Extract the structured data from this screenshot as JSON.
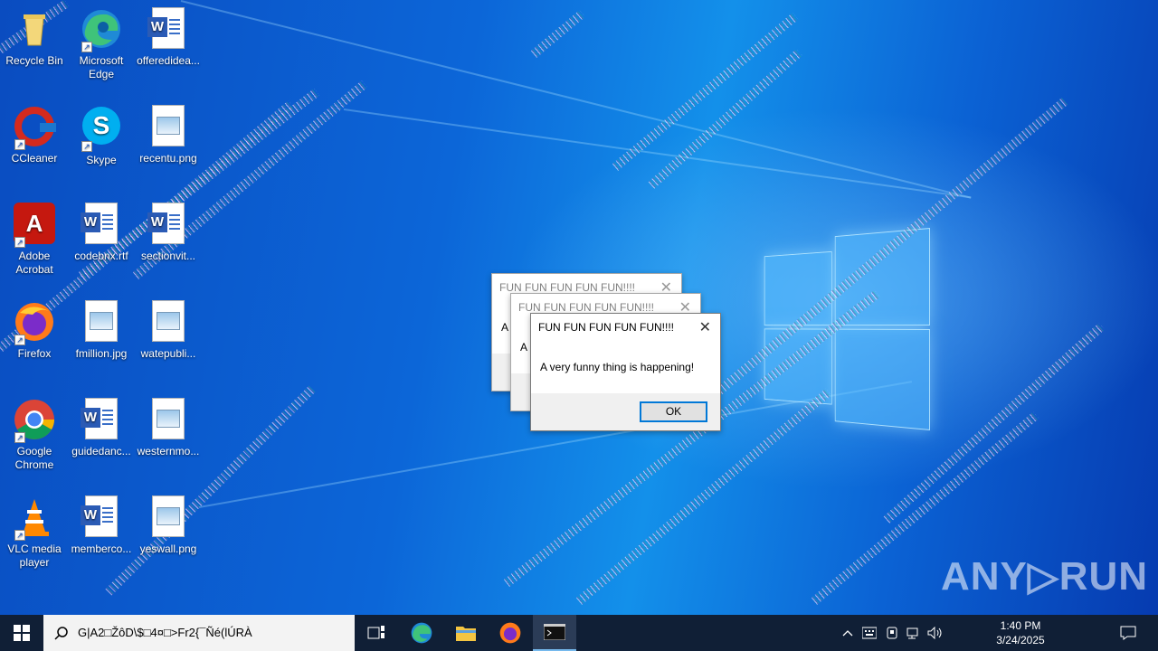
{
  "desktop": {
    "icons": [
      {
        "label": "Recycle Bin"
      },
      {
        "label": "Microsoft Edge"
      },
      {
        "label": "offeredidea..."
      },
      {
        "label": "CCleaner"
      },
      {
        "label": "Skype"
      },
      {
        "label": "recentu.png"
      },
      {
        "label": "Adobe Acrobat"
      },
      {
        "label": "codebnx.rtf"
      },
      {
        "label": "sectionvit..."
      },
      {
        "label": "Firefox"
      },
      {
        "label": "fmillion.jpg"
      },
      {
        "label": "watepubli..."
      },
      {
        "label": "Google Chrome"
      },
      {
        "label": "guidedanc..."
      },
      {
        "label": "westernmo..."
      },
      {
        "label": "VLC media player"
      },
      {
        "label": "memberco..."
      },
      {
        "label": "yeswall.png"
      }
    ]
  },
  "dialogs": [
    {
      "title": "FUN FUN FUN FUN FUN!!!!",
      "message": "A",
      "state": "inactive"
    },
    {
      "title": "FUN FUN FUN FUN FUN!!!!",
      "message": "A",
      "state": "inactive"
    },
    {
      "title": "FUN FUN FUN FUN FUN!!!!",
      "message": "A very funny thing is happening!",
      "ok_label": "OK",
      "state": "active"
    }
  ],
  "taskbar": {
    "search_text": "G|A2□ŽôD\\$□4¤□>Fr2{¯Ñé(lÚRÀ",
    "clock_time": "1:40 PM",
    "clock_date": "3/24/2025",
    "apps": [
      "task-view-icon",
      "edge-icon",
      "file-explorer-icon",
      "firefox-icon",
      "terminal-icon"
    ]
  },
  "watermark": "ANY▷RUN",
  "colors": {
    "taskbar": "#101f36",
    "dialog_accent": "#0078d7",
    "desktop": "#0c66d8"
  }
}
